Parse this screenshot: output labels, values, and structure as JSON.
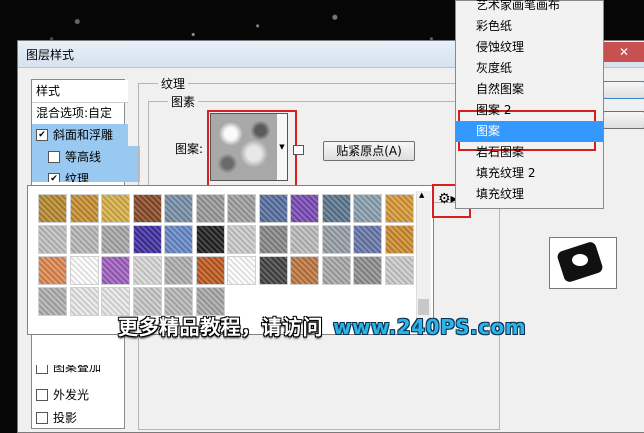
{
  "dialog": {
    "title": "图层样式"
  },
  "left_panel": {
    "header": "样式",
    "items": [
      {
        "label": "混合选项:自定",
        "checkbox": false,
        "checked": false,
        "selected": false
      },
      {
        "label": "斜面和浮雕",
        "checkbox": true,
        "checked": true,
        "selected": true
      },
      {
        "label": "等高线",
        "checkbox": true,
        "checked": false,
        "selected": false
      },
      {
        "label": "纹理",
        "checkbox": true,
        "checked": true,
        "selected": true
      }
    ],
    "lower_items": [
      {
        "label": "图案叠加",
        "checked": false
      },
      {
        "label": "外发光",
        "checked": false
      },
      {
        "label": "投影",
        "checked": false
      }
    ]
  },
  "texture": {
    "group_title": "纹理",
    "subgroup_title": "图素",
    "pattern_label": "图案:",
    "snap_button": "贴紧原点(A)"
  },
  "pattern_picker": {
    "gear_icon": "gear-icon",
    "tiles": [
      [
        "#b88a2e",
        "#c88f30",
        "#d8b048",
        "#8a4a28",
        "#7890a8",
        "#9a9a9a",
        "#a0a0a0",
        "#5870a0",
        "#7a4ab8",
        "#5a7890",
        "#8aa0b0",
        "#d89838"
      ],
      [
        "#c0c0c0",
        "#b8b8b8",
        "#a8a8a8",
        "#4030a0",
        "#6888c8",
        "#222222",
        "#cccccc",
        "#888888",
        "#bcbcbc",
        "#98a0a8",
        "#6878a8",
        "#d08a30"
      ],
      [
        "#e08850",
        "#ffffff",
        "#a060c0",
        "#d8d8d8",
        "#b0b0b0",
        "#c05a20",
        "#ffffff",
        "#444444",
        "#c07840",
        "#a8a8a8",
        "#909090",
        "#cccccc"
      ],
      [
        "#b0b0b0",
        "#e8e8e8",
        "#e8e8e8",
        "#c8c8c8",
        "#b8b8b8",
        "#a8a8a8",
        "",
        "",
        "",
        "",
        "",
        ""
      ]
    ]
  },
  "menu": {
    "items": [
      {
        "label": "艺术家画笔画布",
        "selected": false
      },
      {
        "label": "彩色纸",
        "selected": false
      },
      {
        "label": "侵蚀纹理",
        "selected": false
      },
      {
        "label": "灰度纸",
        "selected": false
      },
      {
        "label": "自然图案",
        "selected": false
      },
      {
        "label": "图案 2",
        "selected": false
      },
      {
        "label": "图案",
        "selected": true
      },
      {
        "label": "岩石图案",
        "selected": false
      },
      {
        "label": "填充纹理 2",
        "selected": false
      },
      {
        "label": "填充纹理",
        "selected": false
      }
    ]
  },
  "watermark": {
    "chinese": "更多精品教程，请访问",
    "url": "www.240PS.com"
  },
  "colors": {
    "highlight": "#3399ff",
    "annotation": "#d6201e",
    "url_blue": "#2bb4e8"
  }
}
